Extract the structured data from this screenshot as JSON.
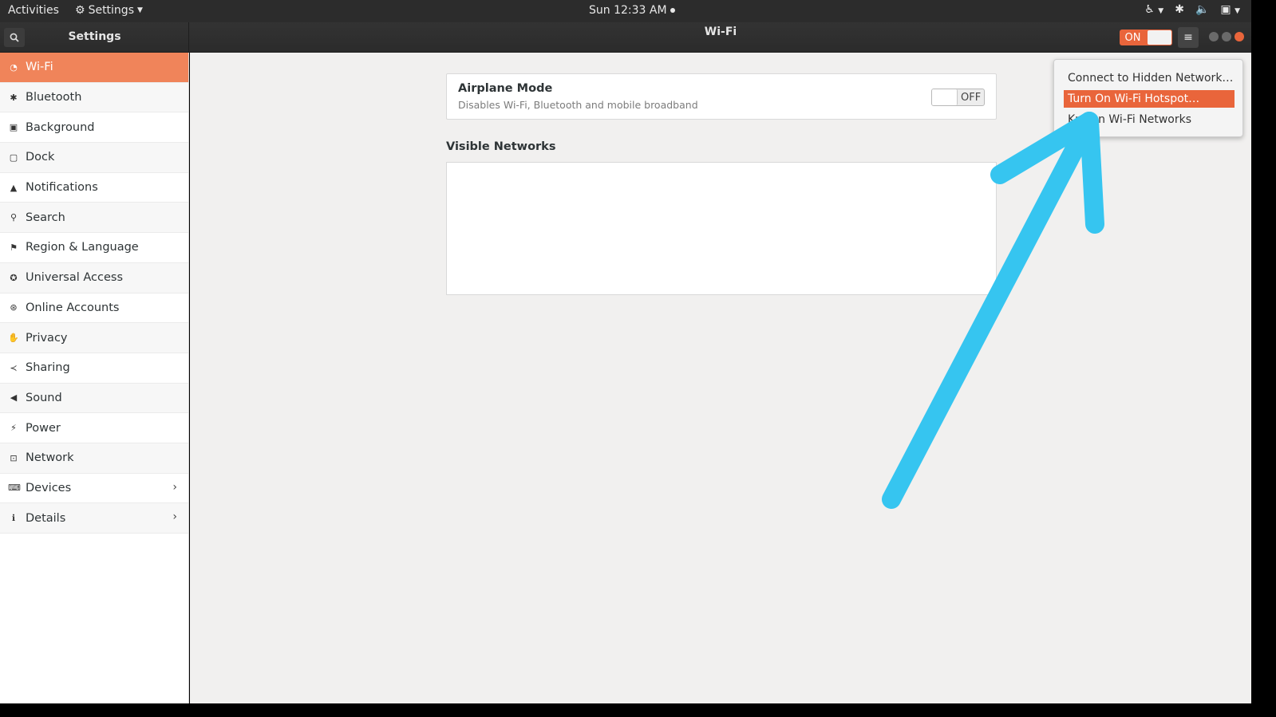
{
  "topbar": {
    "activities": "Activities",
    "app_menu": "Settings",
    "clock": "Sun 12:33 AM"
  },
  "header": {
    "left_title": "Settings",
    "title": "Wi-Fi",
    "wifi_switch": "ON"
  },
  "sidebar": {
    "items": [
      {
        "label": "Wi-Fi",
        "icon": "wifi-icon"
      },
      {
        "label": "Bluetooth",
        "icon": "bluetooth-icon"
      },
      {
        "label": "Background",
        "icon": "background-icon"
      },
      {
        "label": "Dock",
        "icon": "dock-icon"
      },
      {
        "label": "Notifications",
        "icon": "bell-icon"
      },
      {
        "label": "Search",
        "icon": "search-icon"
      },
      {
        "label": "Region & Language",
        "icon": "flag-icon"
      },
      {
        "label": "Universal Access",
        "icon": "accessibility-icon"
      },
      {
        "label": "Online Accounts",
        "icon": "online-accounts-icon"
      },
      {
        "label": "Privacy",
        "icon": "hand-icon"
      },
      {
        "label": "Sharing",
        "icon": "share-icon"
      },
      {
        "label": "Sound",
        "icon": "speaker-icon"
      },
      {
        "label": "Power",
        "icon": "power-icon"
      },
      {
        "label": "Network",
        "icon": "network-icon"
      },
      {
        "label": "Devices",
        "icon": "devices-icon"
      },
      {
        "label": "Details",
        "icon": "info-icon"
      }
    ]
  },
  "airplane": {
    "title": "Airplane Mode",
    "description": "Disables Wi-Fi, Bluetooth and mobile broadband",
    "toggle": "OFF"
  },
  "visible_networks": {
    "title": "Visible Networks"
  },
  "popover": {
    "items": [
      "Connect to Hidden Network…",
      "Turn On Wi-Fi Hotspot…",
      "Known Wi-Fi Networks"
    ]
  },
  "colors": {
    "accent": "#e9653b",
    "sidebar_active": "#f0845a",
    "annotation_arrow": "#36c5f0"
  }
}
